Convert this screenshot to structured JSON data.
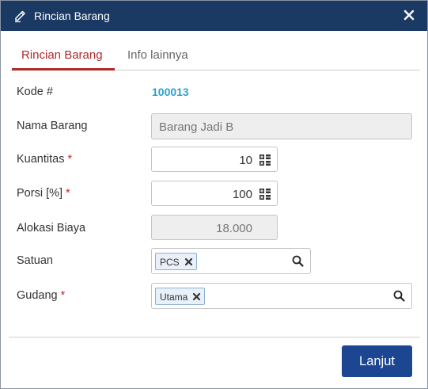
{
  "dialog": {
    "title": "Rincian Barang",
    "icons": {
      "title": "pencil-edit-icon",
      "close": "close-x-icon"
    }
  },
  "tabs": [
    {
      "label": "Rincian Barang",
      "active": true
    },
    {
      "label": "Info lainnya",
      "active": false
    }
  ],
  "form": {
    "kode": {
      "label": "Kode #",
      "value": "100013"
    },
    "nama_barang": {
      "label": "Nama Barang",
      "value": "Barang Jadi B",
      "readonly": true
    },
    "kuantitas": {
      "label": "Kuantitas",
      "required_mark": "*",
      "value": "10",
      "icon": "calculator-icon"
    },
    "porsi": {
      "label": "Porsi [%]",
      "required_mark": "*",
      "value": "100",
      "icon": "calculator-icon"
    },
    "alokasi_biaya": {
      "label": "Alokasi Biaya",
      "value": "18.000",
      "readonly": true
    },
    "satuan": {
      "label": "Satuan",
      "tag": "PCS",
      "icon": "search-icon"
    },
    "gudang": {
      "label": "Gudang",
      "required_mark": "*",
      "tag": "Utama",
      "icon": "search-icon"
    }
  },
  "footer": {
    "next_button": "Lanjut"
  },
  "colors": {
    "titlebar": "#1b3a63",
    "accent_red": "#b02a2a",
    "code_blue": "#2aa3c9",
    "button_blue": "#1c4691"
  }
}
